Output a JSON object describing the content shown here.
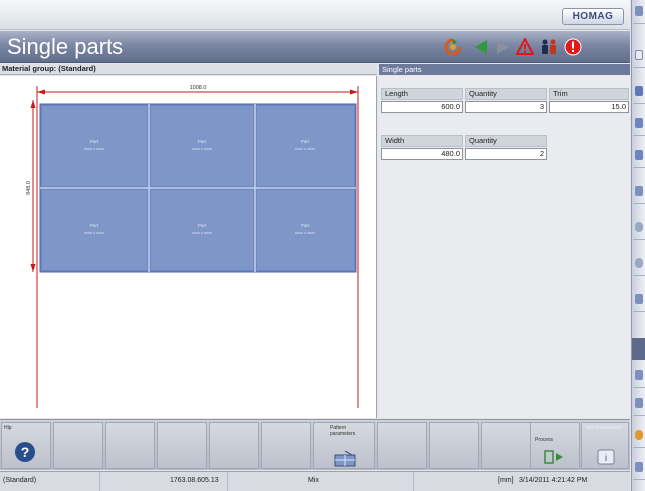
{
  "brand": {
    "logo_text": "HOMAG"
  },
  "header": {
    "title": "Single parts"
  },
  "toolbar": {
    "icons": [
      "refresh-icon",
      "back-arrow-icon",
      "forward-arrow-icon",
      "warning-icon",
      "operators-icon",
      "emergency-stop-icon"
    ]
  },
  "left_panel": {
    "header": "Material group: (Standard)",
    "dimension_top": "1008.0",
    "dimension_side": "948.0",
    "parts": [
      {
        "label": "Part",
        "size": "xxxx x xxxx"
      },
      {
        "label": "Part",
        "size": "xxxx x xxxx"
      },
      {
        "label": "Part",
        "size": "xxxx x xxxx"
      },
      {
        "label": "Part",
        "size": "xxxx x xxxx"
      },
      {
        "label": "Part",
        "size": "xxxx x xxxx"
      },
      {
        "label": "Part",
        "size": "xxxx x xxxx"
      }
    ]
  },
  "right_panel": {
    "header": "Single parts",
    "length_label": "Length",
    "length_value": "600.0",
    "quantity_label_1": "Quantity",
    "quantity_value_1": "3",
    "trim_label": "Trim",
    "trim_value": "15.0",
    "width_label": "Width",
    "width_value": "480.0",
    "quantity_label_2": "Quantity",
    "quantity_value_2": "2"
  },
  "softkeys": {
    "help_label": "Hlp",
    "pattern_label": "Pattern parameters",
    "process_label": "Process",
    "info_label": "Info Parameters"
  },
  "status": {
    "material": "(Standard)",
    "code": "1763.08.605.13",
    "unit_short": "Mix",
    "unit": "[mm]",
    "datetime": "3/14/2011 4:21:42 PM"
  },
  "colors": {
    "accent": "#6e7a99",
    "part_fill": "#7f96c9",
    "dimension_red": "#c81818",
    "brand": "#3d4f7a"
  }
}
